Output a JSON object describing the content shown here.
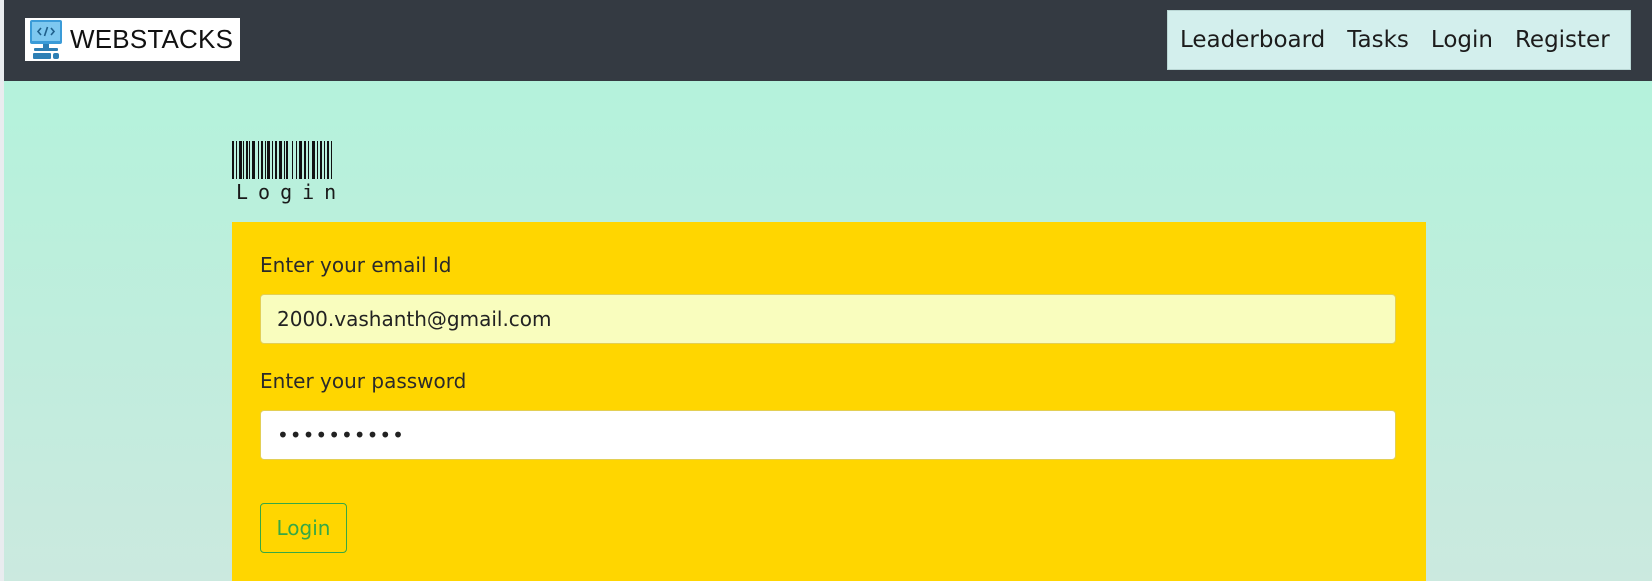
{
  "brand": {
    "name": "WEBSTACKS",
    "logo_icon": "computer-code-icon"
  },
  "nav": {
    "items": [
      {
        "label": "Leaderboard"
      },
      {
        "label": "Tasks"
      },
      {
        "label": "Login"
      },
      {
        "label": "Register"
      }
    ]
  },
  "heading": {
    "barcode_text": "Login",
    "style": "barcode"
  },
  "form": {
    "email_label": "Enter your email Id",
    "email_value": "2000.vashanth@gmail.com",
    "password_label": "Enter your password",
    "password_value": "••••••••••",
    "submit_label": "Login"
  },
  "colors": {
    "navbar": "#343a42",
    "nav_box": "#d3efed",
    "page_bg": "#b1f4db",
    "card": "#ffd600",
    "email_field_bg": "#f9fdbe",
    "button_accent": "#37a845"
  }
}
